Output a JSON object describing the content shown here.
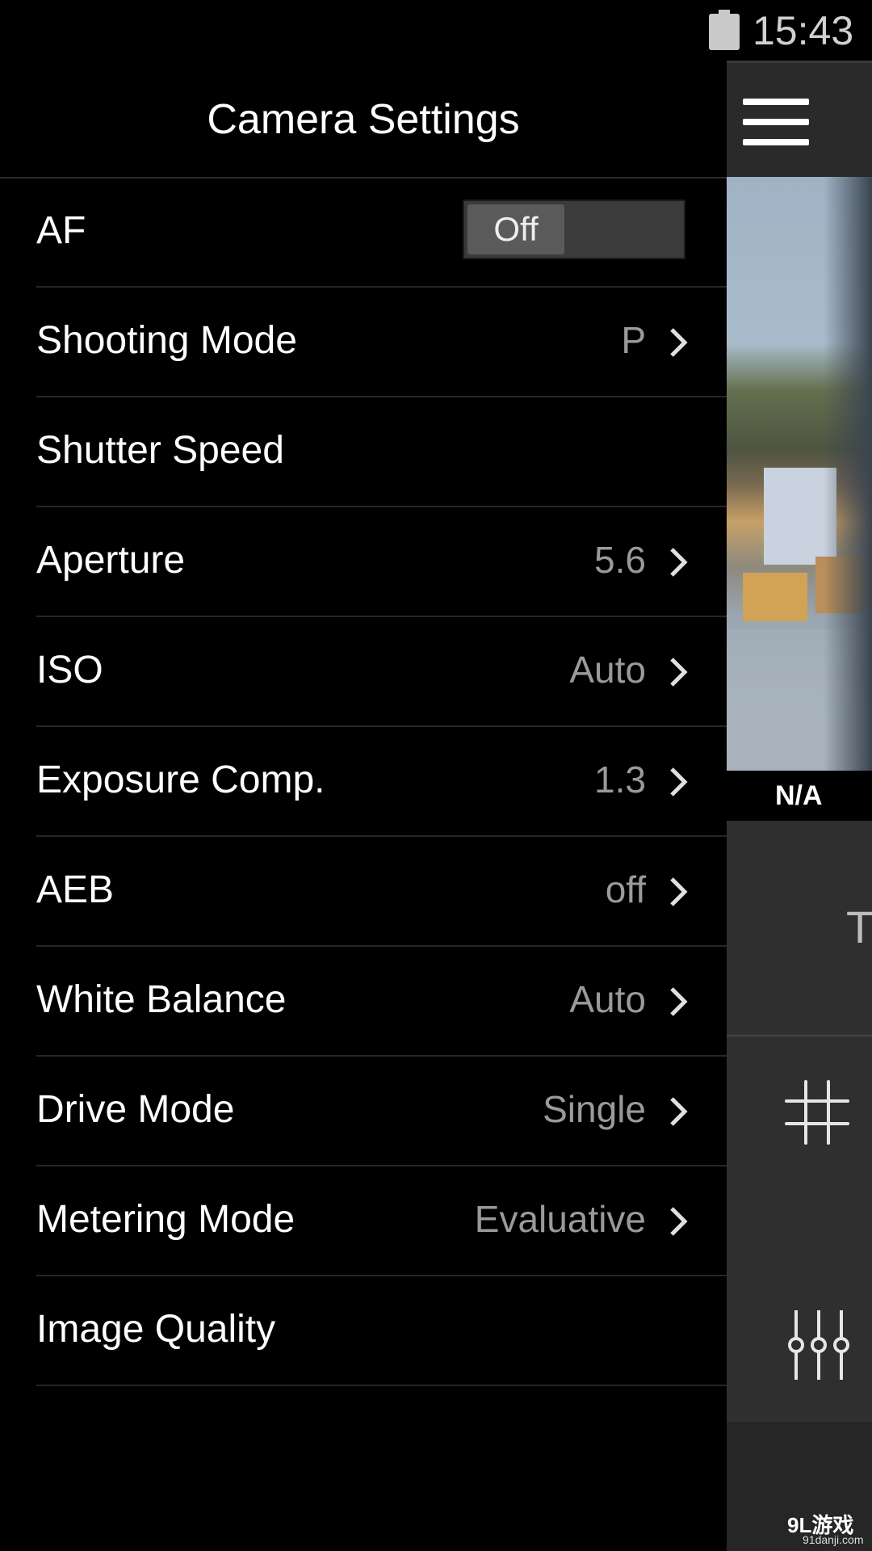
{
  "status_bar": {
    "time": "15:43",
    "battery_icon": "battery-full-icon"
  },
  "drawer": {
    "title": "Camera Settings",
    "af": {
      "label": "AF",
      "toggle_value": "Off",
      "enabled": false
    },
    "items": [
      {
        "label": "Shooting Mode",
        "value": "P",
        "chevron": true
      },
      {
        "label": "Shutter Speed",
        "value": "",
        "chevron": false
      },
      {
        "label": "Aperture",
        "value": "5.6",
        "chevron": true
      },
      {
        "label": "ISO",
        "value": "Auto",
        "chevron": true
      },
      {
        "label": "Exposure Comp.",
        "value": "1.3",
        "chevron": true
      },
      {
        "label": "AEB",
        "value": "off",
        "chevron": true
      },
      {
        "label": "White Balance",
        "value": "Auto",
        "chevron": true
      },
      {
        "label": "Drive Mode",
        "value": "Single",
        "chevron": true
      },
      {
        "label": "Metering Mode",
        "value": "Evaluative",
        "chevron": true
      },
      {
        "label": "Image Quality",
        "value": "",
        "chevron": false
      }
    ]
  },
  "camera_panel": {
    "status_label": "N/A",
    "partial_letter": "T",
    "icons": [
      "menu-icon",
      "grid-icon",
      "sliders-icon",
      "camera-icon"
    ],
    "accent_color": "#1f8cf0"
  },
  "watermark": {
    "main": "9L游戏",
    "sub": "91danji.com"
  }
}
